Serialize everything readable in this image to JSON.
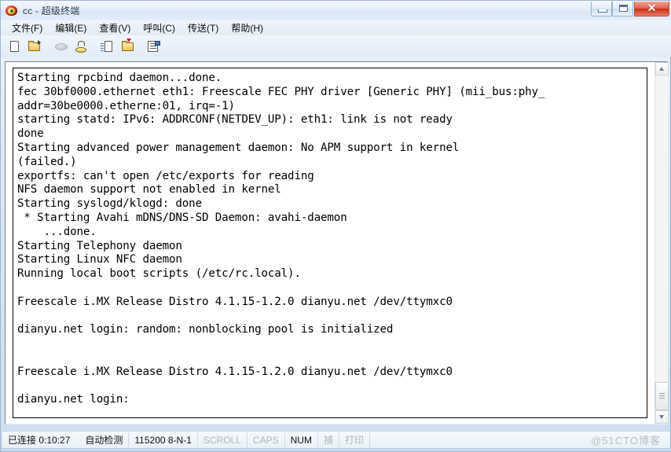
{
  "window": {
    "title": "cc - 超级终端",
    "icon": "hyperterminal-icon",
    "buttons": {
      "minimize": "最小化",
      "maximize": "最大化",
      "close": "✕"
    }
  },
  "menubar": {
    "items": [
      {
        "name": "file",
        "label": "文件(F)"
      },
      {
        "name": "edit",
        "label": "编辑(E)"
      },
      {
        "name": "view",
        "label": "查看(V)"
      },
      {
        "name": "call",
        "label": "呼叫(C)"
      },
      {
        "name": "transfer",
        "label": "传送(T)"
      },
      {
        "name": "help",
        "label": "帮助(H)"
      }
    ]
  },
  "toolbar": {
    "items": [
      {
        "name": "new-connection-icon",
        "icon": "page-icon"
      },
      {
        "name": "open-connection-icon",
        "icon": "folder-open-icon"
      },
      {
        "name": "call-icon",
        "icon": "phone-icon"
      },
      {
        "name": "disconnect-icon",
        "icon": "hangup-icon"
      },
      {
        "name": "send-file-icon",
        "icon": "send-file-icon"
      },
      {
        "name": "receive-file-icon",
        "icon": "receive-file-icon"
      },
      {
        "name": "properties-icon",
        "icon": "properties-icon"
      }
    ]
  },
  "terminal": {
    "lines": [
      "Starting rpcbind daemon...done.",
      "fec 30bf0000.ethernet eth1: Freescale FEC PHY driver [Generic PHY] (mii_bus:phy_",
      "addr=30be0000.etherne:01, irq=-1)",
      "starting statd: IPv6: ADDRCONF(NETDEV_UP): eth1: link is not ready",
      "done",
      "Starting advanced power management daemon: No APM support in kernel",
      "(failed.)",
      "exportfs: can't open /etc/exports for reading",
      "NFS daemon support not enabled in kernel",
      "Starting syslogd/klogd: done",
      " * Starting Avahi mDNS/DNS-SD Daemon: avahi-daemon",
      "    ...done.",
      "Starting Telephony daemon",
      "Starting Linux NFC daemon",
      "Running local boot scripts (/etc/rc.local).",
      "",
      "Freescale i.MX Release Distro 4.1.15-1.2.0 dianyu.net /dev/ttymxc0",
      "",
      "dianyu.net login: random: nonblocking pool is initialized",
      "",
      "",
      "Freescale i.MX Release Distro 4.1.15-1.2.0 dianyu.net /dev/ttymxc0",
      "",
      "dianyu.net login:"
    ]
  },
  "scrollbar": {
    "up_arrow": "▲",
    "down_arrow": "▼"
  },
  "statusbar": {
    "connection": "已连接 0:10:27",
    "detect": "自动检测",
    "serial": "115200 8-N-1",
    "scroll": "SCROLL",
    "caps": "CAPS",
    "num": "NUM",
    "capture": "捕",
    "print": "打印",
    "watermark": "@51CTO博客"
  }
}
